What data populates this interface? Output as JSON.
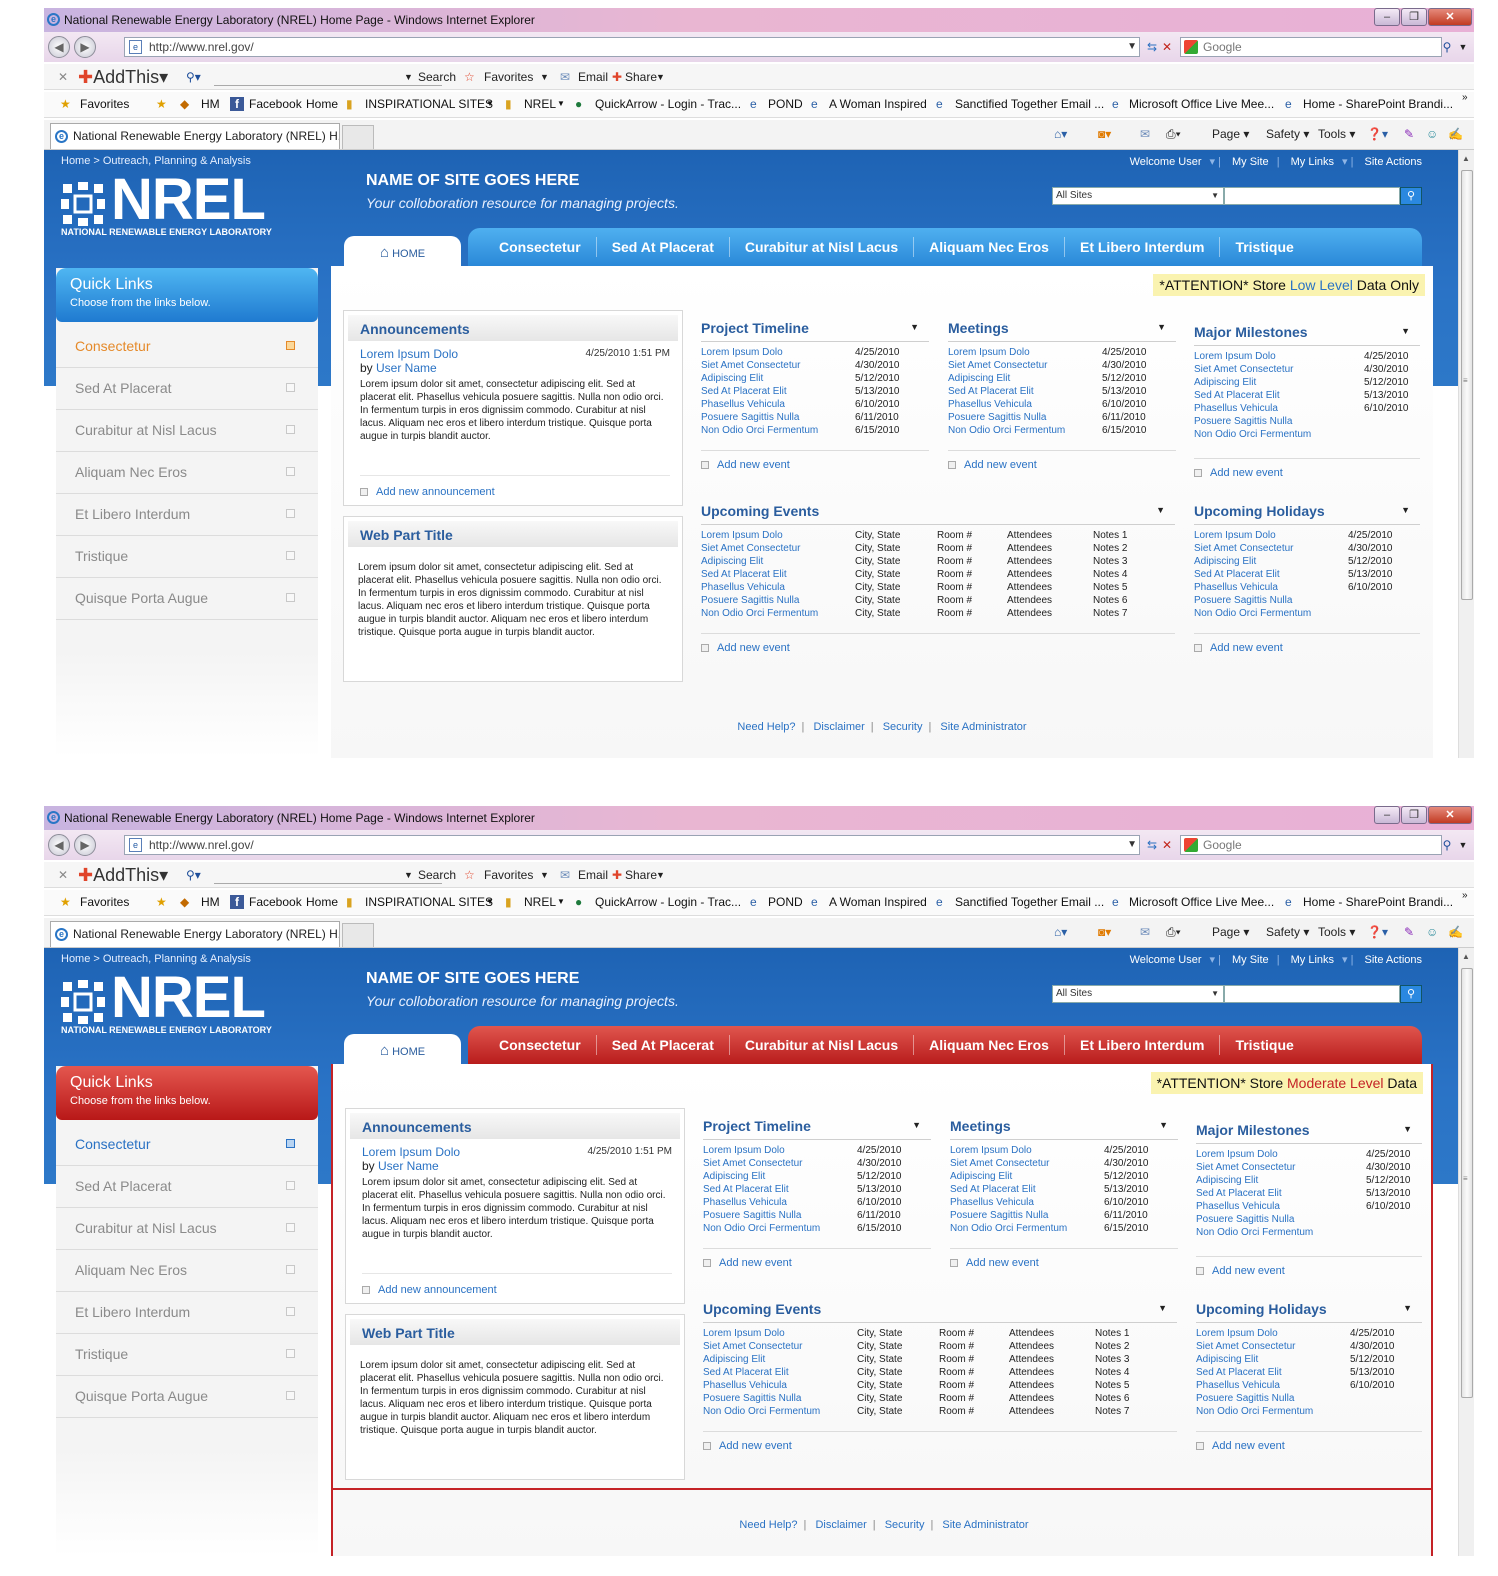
{
  "screens": [
    {
      "id": "blue",
      "attention_prefix": "*ATTENTION* Store ",
      "attention_level": "Low Level",
      "attention_suffix": " Data Only",
      "theme_color": "#2a88d8",
      "active_quicklink_color": "#e58a2a"
    },
    {
      "id": "red",
      "attention_prefix": "*ATTENTION* Store ",
      "attention_level": "Moderate Level",
      "attention_suffix": " Data",
      "theme_color": "#c42226",
      "active_quicklink_color": "#2a72c4"
    }
  ],
  "browser": {
    "window_title": "National Renewable Energy Laboratory (NREL) Home Page - Windows Internet Explorer",
    "url": "http://www.nrel.gov/",
    "search_provider": "Google",
    "addthis": "AddThis",
    "toolbar": {
      "search": "Search",
      "favorites": "Favorites",
      "email": "Email",
      "share": "Share"
    },
    "favorites_label": "Favorites",
    "bookmarks": [
      "HM",
      "Facebook",
      "Home",
      "INSPIRATIONAL SITES",
      "NREL",
      "QuickArrow - Login - Trac...",
      "POND",
      "A Woman Inspired",
      "Sanctified Together Email ...",
      "Microsoft Office Live Mee...",
      "Home - SharePoint Brandi..."
    ],
    "tab_title": "National Renewable Energy Laboratory (NREL) H...",
    "commands": {
      "page": "Page",
      "safety": "Safety",
      "tools": "Tools"
    }
  },
  "site": {
    "breadcrumb": "Home > Outreach, Planning & Analysis",
    "welcome": "Welcome User",
    "my_site": "My Site",
    "my_links": "My Links",
    "site_actions": "Site Actions",
    "logo_word": "NREL",
    "logo_sub": "NATIONAL RENEWABLE ENERGY LABORATORY",
    "site_name": "NAME OF SITE GOES HERE",
    "tagline": "Your colloboration resource for managing projects.",
    "scope": "All Sites",
    "home_tab": "HOME",
    "nav": [
      "Consectetur",
      "Sed At Placerat",
      "Curabitur at Nisl Lacus",
      "Aliquam Nec Eros",
      "Et Libero Interdum",
      "Tristique"
    ]
  },
  "quicklinks": {
    "title": "Quick Links",
    "subtitle": "Choose from the links below.",
    "items": [
      "Consectetur",
      "Sed At Placerat",
      "Curabitur at Nisl Lacus",
      "Aliquam Nec Eros",
      "Et Libero Interdum",
      "Tristique",
      "Quisque Porta Augue"
    ]
  },
  "announcements": {
    "title": "Announcements",
    "item_title": "Lorem Ipsum Dolo",
    "date": "4/25/2010 1:51 PM",
    "by": "by ",
    "author": "User Name",
    "body": "Lorem ipsum dolor sit amet, consectetur adipiscing elit. Sed at placerat elit. Phasellus vehicula posuere sagittis. Nulla non odio orci. In fermentum turpis in eros dignissim commodo. Curabitur at nisl lacus. Aliquam nec eros et libero interdum tristique. Quisque porta augue in turpis blandit auctor.",
    "add": "Add new announcement"
  },
  "webpart": {
    "title": "Web Part Title",
    "body": "Lorem ipsum dolor sit amet, consectetur adipiscing elit. Sed at placerat elit. Phasellus vehicula posuere sagittis. Nulla non odio orci. In fermentum turpis in eros dignissim commodo. Curabitur at nisl lacus. Aliquam nec eros et libero interdum tristique. Quisque porta augue in turpis blandit auctor. Aliquam nec eros et libero interdum tristique. Quisque porta augue in turpis blandit auctor."
  },
  "lists": {
    "project_timeline": {
      "title": "Project Timeline",
      "add": "Add new event",
      "items": [
        "Lorem Ipsum Dolo",
        "Siet Amet Consectetur",
        "Adipiscing Elit",
        "Sed At Placerat Elit",
        "Phasellus Vehicula",
        "Posuere Sagittis Nulla",
        "Non Odio Orci Fermentum"
      ],
      "dates": [
        "4/25/2010",
        "4/30/2010",
        "5/12/2010",
        "5/13/2010",
        "6/10/2010",
        "6/11/2010",
        "6/15/2010"
      ]
    },
    "meetings": {
      "title": "Meetings",
      "add": "Add new event",
      "items": [
        "Lorem Ipsum Dolo",
        "Siet Amet Consectetur",
        "Adipiscing Elit",
        "Sed At Placerat Elit",
        "Phasellus Vehicula",
        "Posuere Sagittis Nulla",
        "Non Odio Orci Fermentum"
      ],
      "dates": [
        "4/25/2010",
        "4/30/2010",
        "5/12/2010",
        "5/13/2010",
        "6/10/2010",
        "6/11/2010",
        "6/15/2010"
      ]
    },
    "major_milestones": {
      "title": "Major Milestones",
      "add": "Add new event",
      "items": [
        "Lorem Ipsum Dolo",
        "Siet Amet Consectetur",
        "Adipiscing Elit",
        "Sed At Placerat Elit",
        "Phasellus Vehicula",
        "Posuere Sagittis Nulla",
        "Non Odio Orci Fermentum"
      ],
      "dates": [
        "4/25/2010",
        "4/30/2010",
        "5/12/2010",
        "5/13/2010",
        "6/10/2010"
      ]
    },
    "upcoming_events": {
      "title": "Upcoming Events",
      "add": "Add new event",
      "items": [
        "Lorem Ipsum Dolo",
        "Siet Amet Consectetur",
        "Adipiscing Elit",
        "Sed At Placerat Elit",
        "Phasellus Vehicula",
        "Posuere Sagittis Nulla",
        "Non Odio Orci Fermentum"
      ],
      "city": "City, State",
      "room": "Room #",
      "attendees": "Attendees",
      "notes": [
        "Notes 1",
        "Notes 2",
        "Notes 3",
        "Notes 4",
        "Notes 5",
        "Notes 6",
        "Notes 7"
      ]
    },
    "upcoming_holidays": {
      "title": "Upcoming Holidays",
      "add": "Add new event",
      "items": [
        "Lorem Ipsum Dolo",
        "Siet Amet Consectetur",
        "Adipiscing Elit",
        "Sed At Placerat Elit",
        "Phasellus Vehicula",
        "Posuere Sagittis Nulla",
        "Non Odio Orci Fermentum"
      ],
      "dates": [
        "4/25/2010",
        "4/30/2010",
        "5/12/2010",
        "5/13/2010",
        "6/10/2010"
      ]
    }
  },
  "footer": {
    "help": "Need Help?",
    "disclaimer": "Disclaimer",
    "security": "Security",
    "admin": "Site Administrator"
  }
}
